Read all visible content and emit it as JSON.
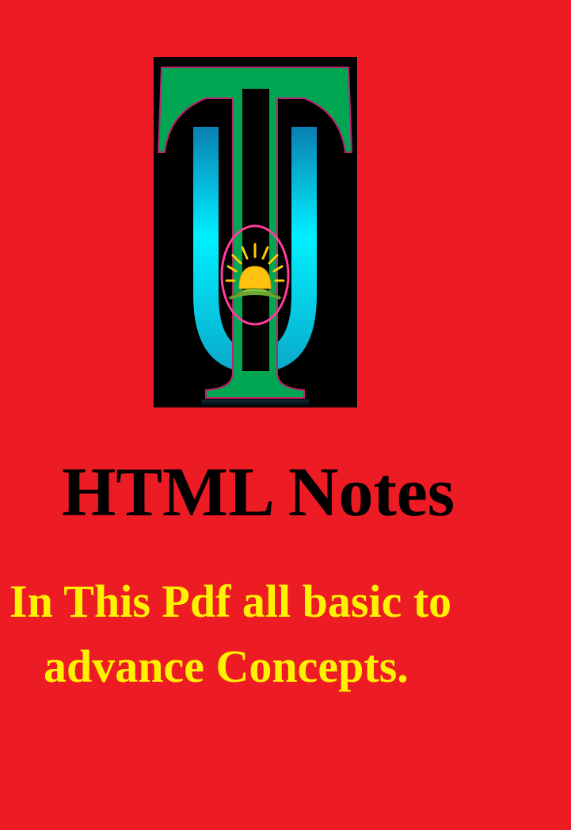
{
  "cover": {
    "logo_icon": "tu-sunrise-logo-icon",
    "title": "HTML Notes",
    "subtitle_line1": "In This Pdf all basic to",
    "subtitle_line2": "advance Concepts."
  },
  "colors": {
    "background": "#ed1c24",
    "title": "#000000",
    "subtitle": "#fff200",
    "logo_green": "#00a651",
    "logo_cyan": "#00e5ff",
    "logo_ring": "#ff3d9a"
  }
}
